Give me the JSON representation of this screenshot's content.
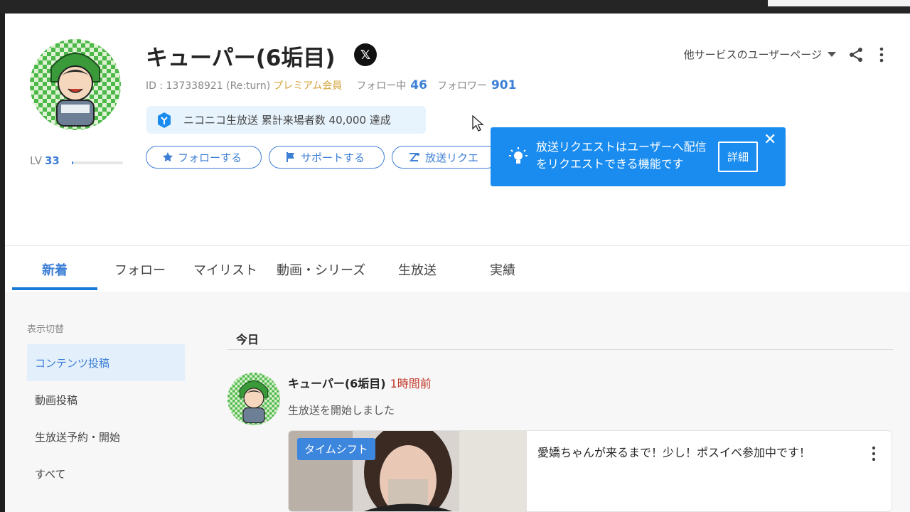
{
  "profile": {
    "name": "キューパー(6垢目)",
    "id_text": "ID : 137338921 (Re:turn)",
    "premium": "プレミアム会員",
    "following_label": "フォロー中",
    "following_count": "46",
    "followers_label": "フォロワー",
    "followers_count": "901",
    "social_icon": "x-logo-icon",
    "level_label": "LV",
    "level": "33",
    "level_progress": 0.03,
    "achievement": "ニコニコ生放送 累計来場者数 40,000 達成"
  },
  "actions": {
    "follow": "フォローする",
    "support": "サポートする",
    "request": "放送リクエ"
  },
  "header_menu": {
    "other_services": "他サービスのユーザーページ"
  },
  "tooltip": {
    "message": "放送リクエストはユーザーへ配信をリクエストできる機能です",
    "detail": "詳細",
    "close": "✕"
  },
  "tabs": [
    {
      "label": "新着",
      "active": true
    },
    {
      "label": "フォロー"
    },
    {
      "label": "マイリスト"
    },
    {
      "label": "動画・シリーズ"
    },
    {
      "label": "生放送"
    },
    {
      "label": "実績"
    }
  ],
  "sidebar": {
    "title": "表示切替",
    "items": [
      {
        "label": "コンテンツ投稿",
        "active": true
      },
      {
        "label": "動画投稿"
      },
      {
        "label": "生放送予約・開始"
      },
      {
        "label": "すべて"
      }
    ]
  },
  "feed": {
    "section_title": "今日",
    "post": {
      "author": "キューパー(6垢目)",
      "time": "1時間前",
      "action": "生放送を開始しました",
      "badge": "タイムシフト",
      "title": "愛嬌ちゃんが来るまで！少し！ポスイベ参加中です！"
    }
  },
  "colors": {
    "accent": "#3d7fd6",
    "tooltip_bg": "#1a8cf0",
    "premium": "#d3a43b",
    "time": "#c0392b"
  }
}
